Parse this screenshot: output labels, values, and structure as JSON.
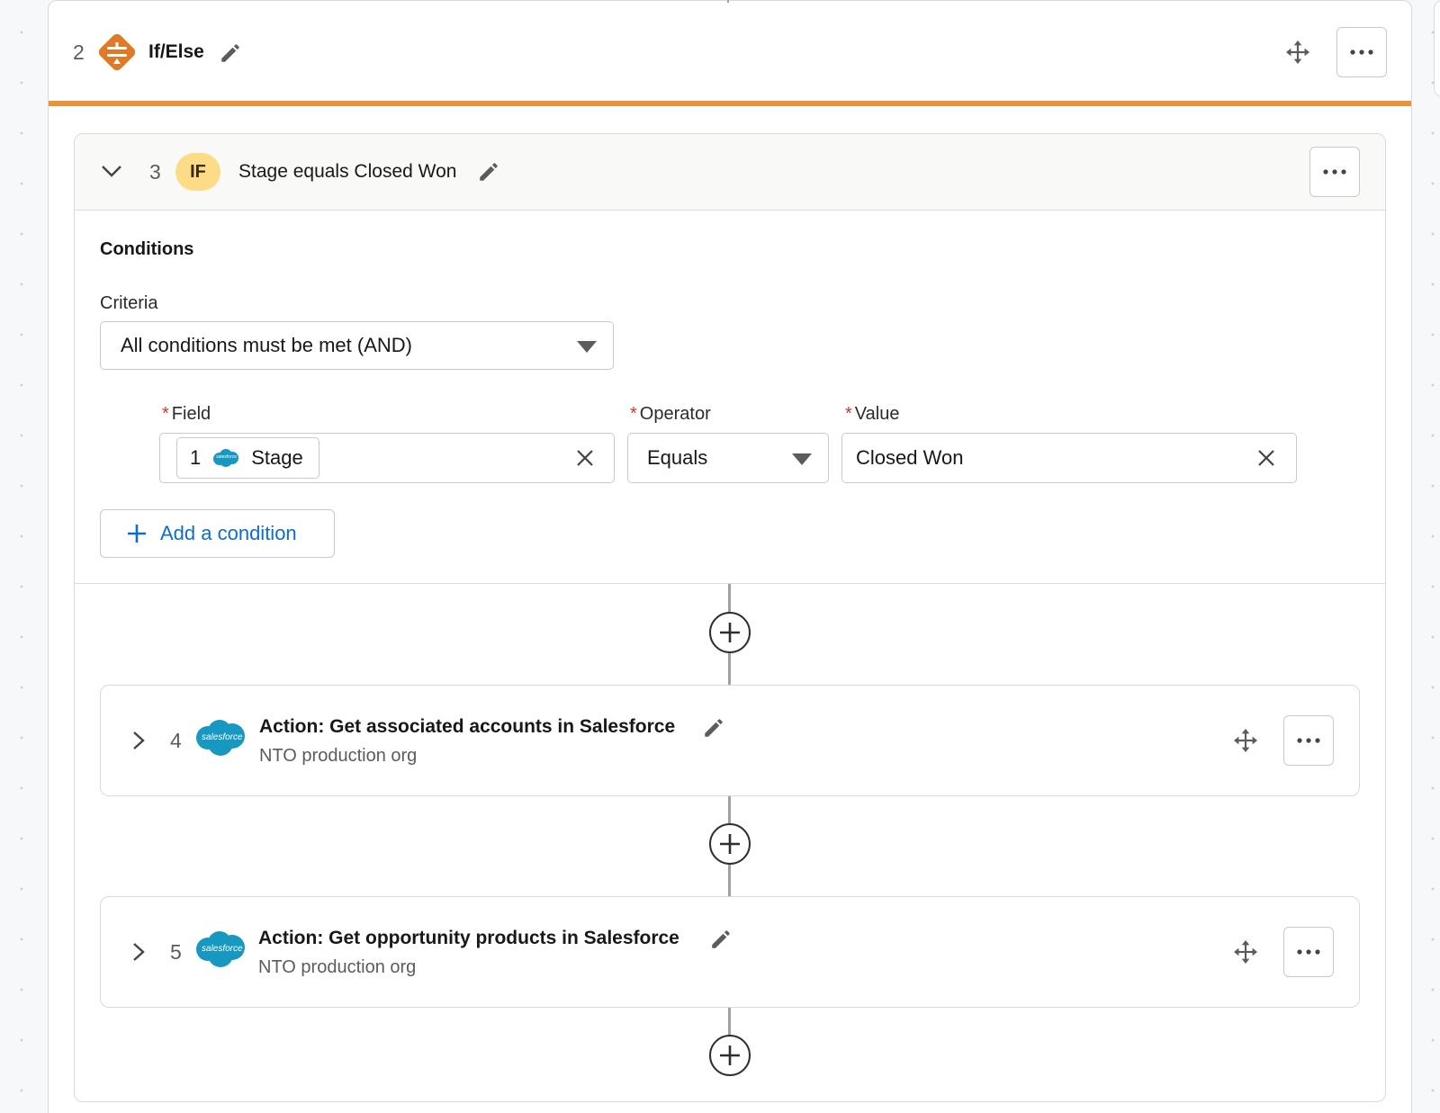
{
  "if_else_step": {
    "number": "2",
    "title": "If/Else",
    "icon": "if-else-branch-icon",
    "accent_color": "#e8953a"
  },
  "if_branch": {
    "number": "3",
    "badge": "IF",
    "title": "Stage equals Closed Won",
    "badge_color": "#fddc87",
    "conditions": {
      "section_title": "Conditions",
      "criteria_label": "Criteria",
      "criteria_value": "All conditions must be met (AND)",
      "field_label": "Field",
      "operator_label": "Operator",
      "value_label": "Value",
      "field_pill": {
        "step_ref": "1",
        "logo_text": "salesforce",
        "name": "Stage"
      },
      "operator_value": "Equals",
      "value_value": "Closed Won",
      "add_condition_label": "Add a condition"
    }
  },
  "actions": [
    {
      "number": "4",
      "logo_text": "salesforce",
      "title": "Action: Get associated accounts in Salesforce",
      "subtitle": "NTO production org"
    },
    {
      "number": "5",
      "logo_text": "salesforce",
      "title": "Action: Get opportunity products in Salesforce",
      "subtitle": "NTO production org"
    }
  ],
  "colors": {
    "link_blue": "#0b6ecf",
    "salesforce_blue": "#1798c1",
    "required_red": "#c23934"
  }
}
